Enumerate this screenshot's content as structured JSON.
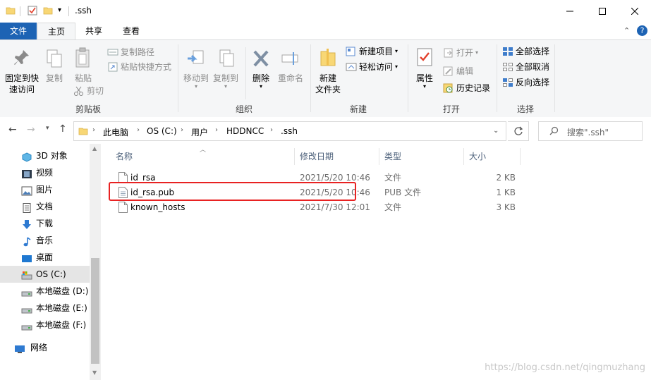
{
  "window": {
    "title": ".ssh"
  },
  "ribbon_tabs": [
    "文件",
    "主页",
    "共享",
    "查看"
  ],
  "ribbon": {
    "clipboard": {
      "title": "剪贴板",
      "pin": "固定到快速访问",
      "pin_line1": "固定到快",
      "pin_line2": "速访问",
      "copy": "复制",
      "paste": "粘贴",
      "copy_path": "复制路径",
      "paste_shortcut": "粘贴快捷方式",
      "cut": "剪切"
    },
    "organize": {
      "title": "组织",
      "move_to": "移动到",
      "copy_to": "复制到",
      "delete": "删除",
      "rename": "重命名"
    },
    "new": {
      "title": "新建",
      "new_folder_line1": "新建",
      "new_folder_line2": "文件夹",
      "new_item": "新建项目",
      "easy_access": "轻松访问"
    },
    "open": {
      "title": "打开",
      "properties": "属性",
      "open": "打开",
      "edit": "编辑",
      "history": "历史记录"
    },
    "select": {
      "title": "选择",
      "select_all": "全部选择",
      "select_none": "全部取消",
      "invert": "反向选择"
    }
  },
  "address": {
    "breadcrumbs": [
      "此电脑",
      "OS (C:)",
      "用户",
      "HDDNCC",
      ".ssh"
    ],
    "search_placeholder": "搜索\".ssh\""
  },
  "nav_items": [
    {
      "label": "3D 对象",
      "icon": "3d-objects-icon"
    },
    {
      "label": "视频",
      "icon": "video-icon"
    },
    {
      "label": "图片",
      "icon": "pictures-icon"
    },
    {
      "label": "文档",
      "icon": "documents-icon"
    },
    {
      "label": "下载",
      "icon": "downloads-icon"
    },
    {
      "label": "音乐",
      "icon": "music-icon"
    },
    {
      "label": "桌面",
      "icon": "desktop-icon"
    },
    {
      "label": "OS (C:)",
      "icon": "os-drive-icon",
      "selected": true
    },
    {
      "label": "本地磁盘 (D:)",
      "icon": "drive-icon"
    },
    {
      "label": "本地磁盘 (E:)",
      "icon": "drive-icon"
    },
    {
      "label": "本地磁盘 (F:)",
      "icon": "drive-icon"
    },
    {
      "label": "网络",
      "icon": "network-icon"
    }
  ],
  "columns": {
    "name": "名称",
    "modified": "修改日期",
    "type": "类型",
    "size": "大小"
  },
  "files": [
    {
      "name": "id_rsa",
      "modified": "2021/5/20 10:46",
      "type": "文件",
      "size": "2 KB"
    },
    {
      "name": "id_rsa.pub",
      "modified": "2021/5/20 10:46",
      "type": "PUB 文件",
      "size": "1 KB"
    },
    {
      "name": "known_hosts",
      "modified": "2021/7/30 12:01",
      "type": "文件",
      "size": "3 KB"
    }
  ],
  "watermark": "https://blog.csdn.net/qingmuzhang",
  "colors": {
    "accent": "#1d63b4",
    "highlight_box": "#e82222",
    "selected_nav": "#e5e5e5"
  }
}
